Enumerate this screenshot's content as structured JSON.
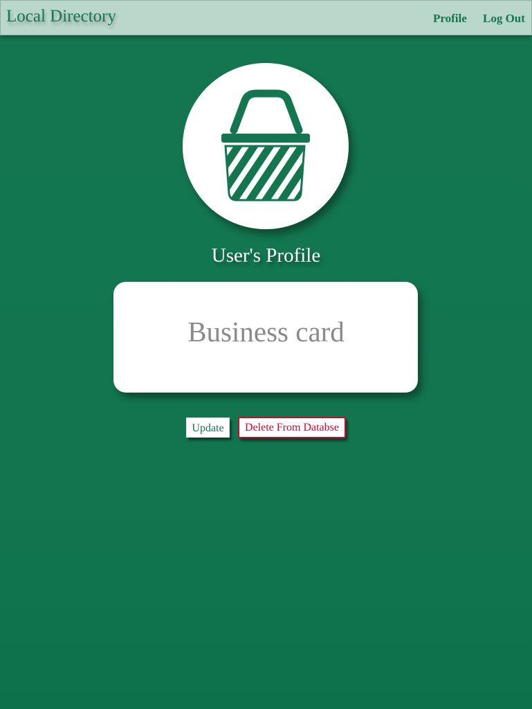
{
  "navbar": {
    "brand": "Local Directory",
    "links": {
      "profile": "Profile",
      "logout": "Log Out"
    }
  },
  "avatar": {
    "icon": "shopping-basket-icon"
  },
  "profile": {
    "title": "User's Profile"
  },
  "card": {
    "text": "Business card"
  },
  "actions": {
    "update_label": "Update",
    "delete_label": "Delete From Databse"
  },
  "colors": {
    "background": "#13764f",
    "navbar": "#bad7cb",
    "primary": "#13764f",
    "danger": "#c9082e",
    "card_text": "#8a8a8a"
  }
}
